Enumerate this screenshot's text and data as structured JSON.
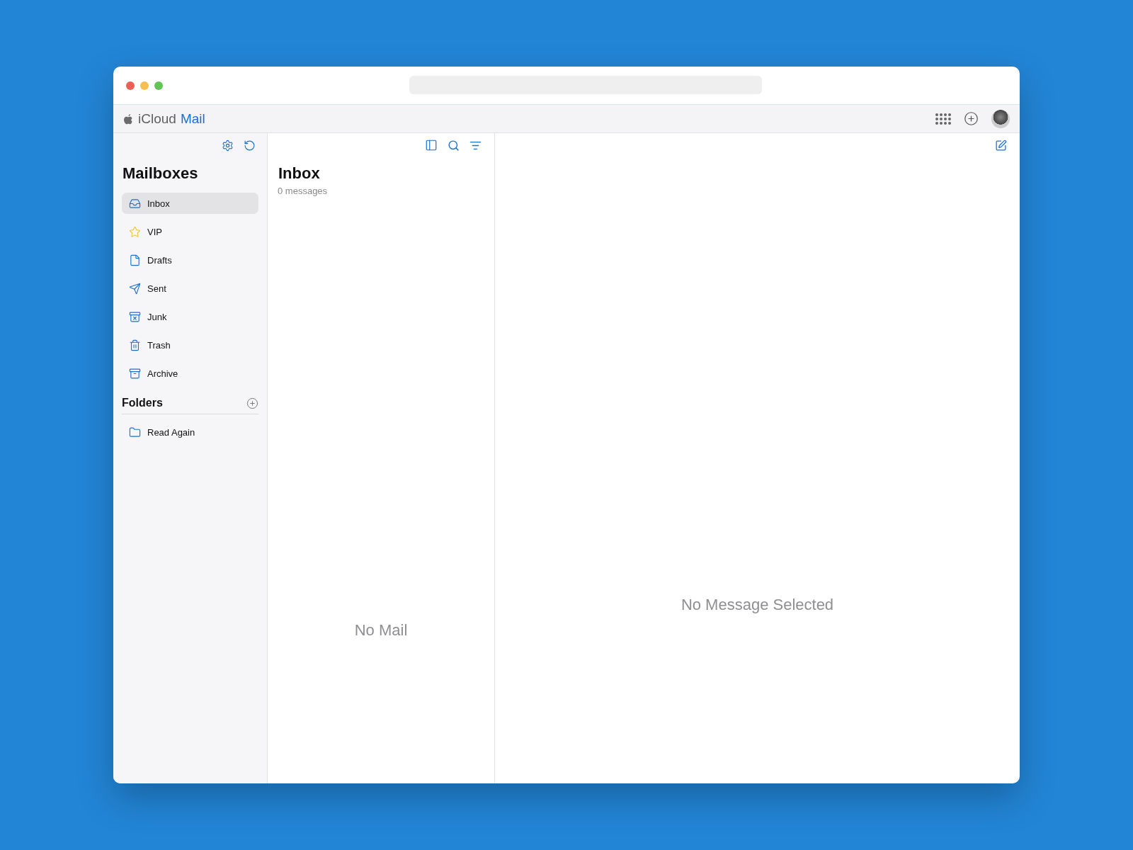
{
  "header": {
    "brand": "iCloud",
    "app": "Mail"
  },
  "sidebar": {
    "title": "Mailboxes",
    "items": [
      {
        "label": "Inbox",
        "kind": "inbox",
        "selected": true
      },
      {
        "label": "VIP",
        "kind": "vip",
        "selected": false
      },
      {
        "label": "Drafts",
        "kind": "drafts",
        "selected": false
      },
      {
        "label": "Sent",
        "kind": "sent",
        "selected": false
      },
      {
        "label": "Junk",
        "kind": "junk",
        "selected": false
      },
      {
        "label": "Trash",
        "kind": "trash",
        "selected": false
      },
      {
        "label": "Archive",
        "kind": "archive",
        "selected": false
      }
    ],
    "folders_title": "Folders",
    "folders": [
      {
        "label": "Read Again",
        "kind": "folder",
        "selected": false
      }
    ]
  },
  "message_list": {
    "title": "Inbox",
    "count": "0 messages",
    "empty": "No Mail"
  },
  "reader": {
    "empty": "No Message Selected"
  }
}
